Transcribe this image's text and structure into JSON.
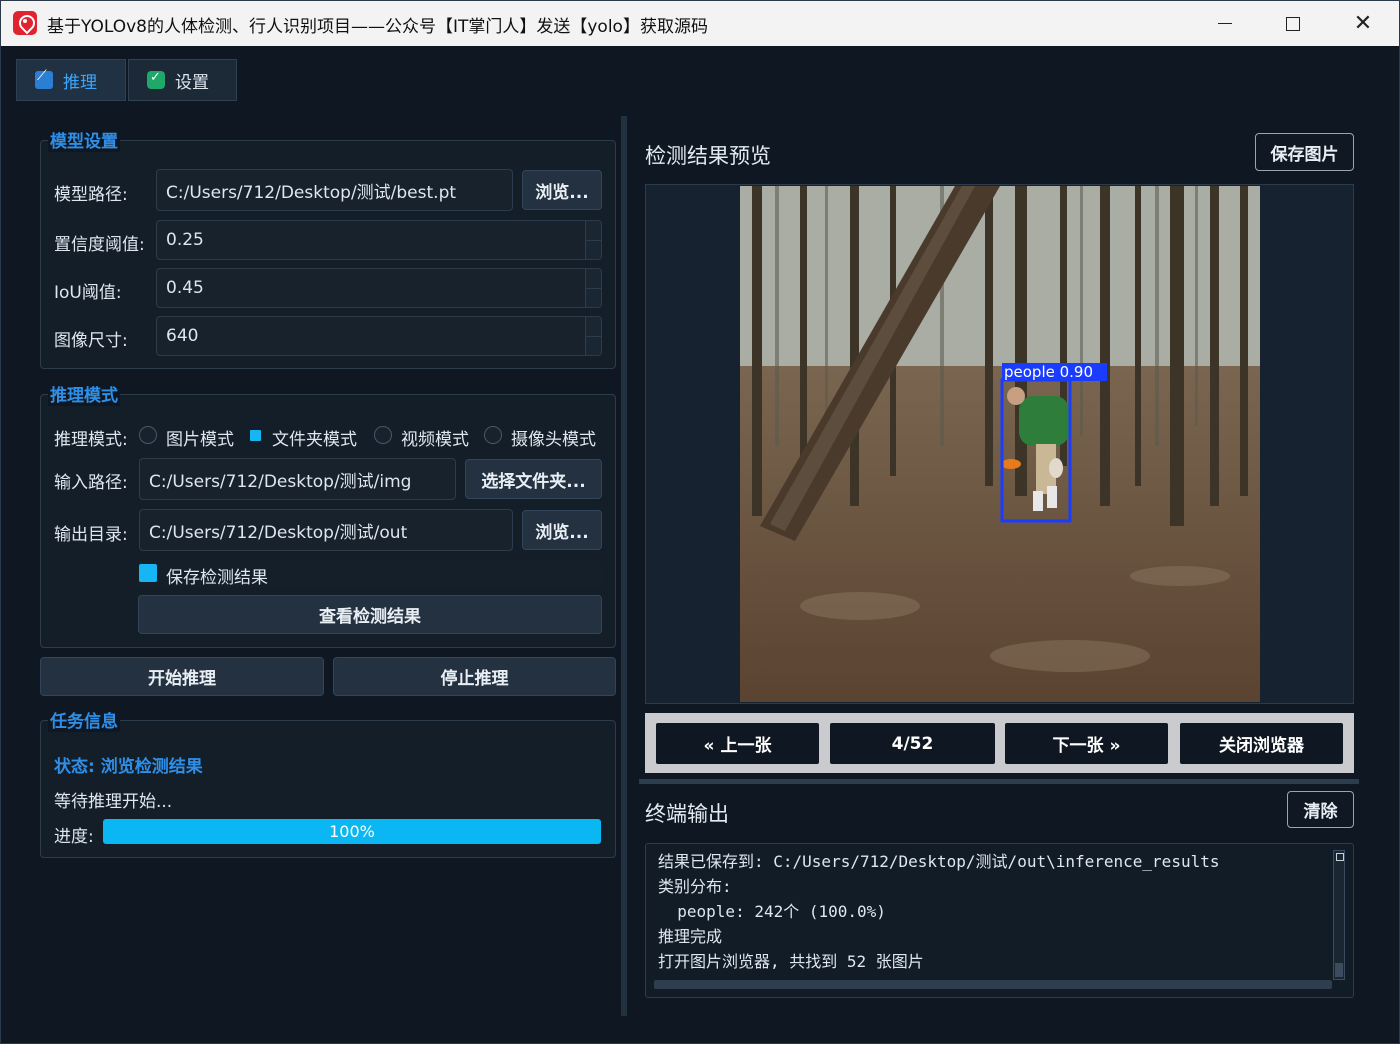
{
  "window": {
    "title": "基于YOLOv8的人体检测、行人识别项目——公众号【IT掌门人】发送【yolo】获取源码"
  },
  "tabs": [
    {
      "label": "推理",
      "icon": "chart-icon",
      "active": true
    },
    {
      "label": "设置",
      "icon": "check-icon",
      "active": false
    }
  ],
  "model_settings": {
    "title": "模型设置",
    "model_path_label": "模型路径:",
    "model_path_value": "C:/Users/712/Desktop/测试/best.pt",
    "browse_label": "浏览...",
    "conf_label": "置信度阈值:",
    "conf_value": "0.25",
    "iou_label": "IoU阈值:",
    "iou_value": "0.45",
    "imgsz_label": "图像尺寸:",
    "imgsz_value": "640"
  },
  "inference_mode": {
    "title": "推理模式",
    "mode_label": "推理模式:",
    "modes": [
      {
        "label": "图片模式",
        "checked": false
      },
      {
        "label": "文件夹模式",
        "checked": true
      },
      {
        "label": "视频模式",
        "checked": false
      },
      {
        "label": "摄像头模式",
        "checked": false
      }
    ],
    "input_label": "输入路径:",
    "input_value": "C:/Users/712/Desktop/测试/img",
    "select_folder_label": "选择文件夹...",
    "output_label": "输出目录:",
    "output_value": "C:/Users/712/Desktop/测试/out",
    "output_browse_label": "浏览...",
    "save_results_label": "保存检测结果",
    "save_results_checked": true,
    "view_results_label": "查看检测结果"
  },
  "actions": {
    "start_label": "开始推理",
    "stop_label": "停止推理"
  },
  "task_info": {
    "title": "任务信息",
    "status": "状态: 浏览检测结果",
    "message": "等待推理开始...",
    "progress_label": "进度:",
    "progress_value": 1.0,
    "progress_text": "100%"
  },
  "preview": {
    "title": "检测结果预览",
    "save_image_label": "保存图片",
    "detection_label": "people  0.90",
    "detection_color": "#1a3cff"
  },
  "navigation": {
    "prev_label": "« 上一张",
    "counter": "4/52",
    "next_label": "下一张 »",
    "close_label": "关闭浏览器"
  },
  "terminal": {
    "title": "终端输出",
    "clear_label": "清除",
    "lines": [
      "结果已保存到: C:/Users/712/Desktop/测试/out\\inference_results",
      "类别分布:",
      "  people: 242个 (100.0%)",
      "推理完成",
      "打开图片浏览器, 共找到 52 张图片"
    ]
  },
  "colors": {
    "accent": "#2f8fe8",
    "progress": "#0bb7f2",
    "background": "#0f1822"
  }
}
